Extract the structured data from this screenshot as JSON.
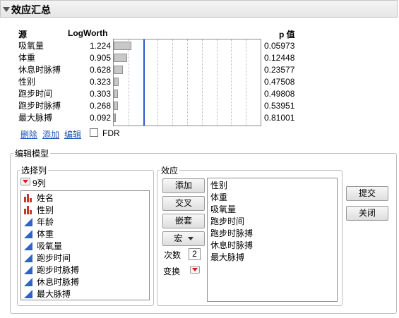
{
  "header": {
    "title": "效应汇总"
  },
  "summary": {
    "col_source": "源",
    "col_logworth": "LogWorth",
    "col_pvalue": "p 值",
    "rows": [
      {
        "source": "吸氧量",
        "logworth": "1.224",
        "pvalue": "0.05973",
        "lw": 1.224
      },
      {
        "source": "体重",
        "logworth": "0.905",
        "pvalue": "0.12448",
        "lw": 0.905
      },
      {
        "source": "休息时脉搏",
        "logworth": "0.628",
        "pvalue": "0.23577",
        "lw": 0.628
      },
      {
        "source": "性别",
        "logworth": "0.323",
        "pvalue": "0.47508",
        "lw": 0.323
      },
      {
        "source": "跑步时间",
        "logworth": "0.303",
        "pvalue": "0.49808",
        "lw": 0.303
      },
      {
        "source": "跑步时脉搏",
        "logworth": "0.268",
        "pvalue": "0.53951",
        "lw": 0.268
      },
      {
        "source": "最大脉搏",
        "logworth": "0.092",
        "pvalue": "0.81001",
        "lw": 0.092
      }
    ],
    "reference_logworth": 2.0,
    "plot_max_logworth": 10,
    "links": {
      "remove": "删除",
      "add": "添加",
      "edit": "编辑"
    },
    "fdr_label": "FDR",
    "fdr_checked": false
  },
  "model": {
    "group_title": "编辑模型",
    "select_columns": {
      "title": "选择列",
      "count_label": "9列",
      "columns": [
        {
          "name": "姓名",
          "type": "nominal"
        },
        {
          "name": "性别",
          "type": "nominal"
        },
        {
          "name": "年龄",
          "type": "continuous"
        },
        {
          "name": "体重",
          "type": "continuous"
        },
        {
          "name": "吸氧量",
          "type": "continuous"
        },
        {
          "name": "跑步时间",
          "type": "continuous"
        },
        {
          "name": "跑步时脉搏",
          "type": "continuous"
        },
        {
          "name": "休息时脉搏",
          "type": "continuous"
        },
        {
          "name": "最大脉搏",
          "type": "continuous"
        }
      ]
    },
    "effects": {
      "title": "效应",
      "buttons": {
        "add": "添加",
        "cross": "交叉",
        "nest": "嵌套",
        "macros": "宏"
      },
      "degree_label": "次数",
      "degree_value": "2",
      "transform_label": "变换",
      "list": [
        "性别",
        "体重",
        "吸氧量",
        "跑步时间",
        "跑步时脉搏",
        "休息时脉搏",
        "最大脉搏"
      ]
    },
    "actions": {
      "submit": "提交",
      "close": "关闭"
    }
  },
  "colors": {
    "reference_line": "#2b56c9",
    "link": "#1f56b7",
    "nominal_icon": "#c0392b",
    "continuous_icon": "#2e64c9",
    "red_triangle": "#d71a1a"
  }
}
